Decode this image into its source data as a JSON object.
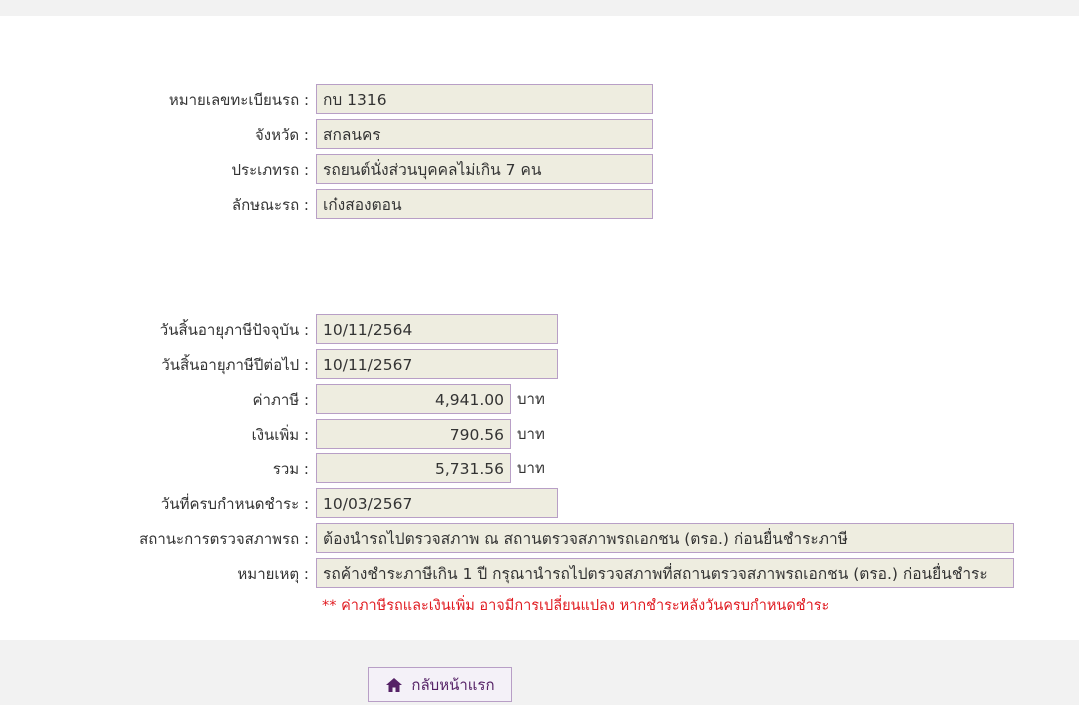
{
  "vehicle": {
    "plate_label": "หมายเลขทะเบียนรถ :",
    "plate_value": "กบ 1316",
    "province_label": "จังหวัด :",
    "province_value": "สกลนคร",
    "type_label": "ประเภทรถ :",
    "type_value": "รถยนต์นั่งส่วนบุคคลไม่เกิน 7 คน",
    "style_label": "ลักษณะรถ :",
    "style_value": "เก๋งสองตอน"
  },
  "tax": {
    "current_expiry_label": "วันสิ้นอายุภาษีปัจจุบัน :",
    "current_expiry_value": "10/11/2564",
    "next_expiry_label": "วันสิ้นอายุภาษีปีต่อไป :",
    "next_expiry_value": "10/11/2567",
    "tax_label": "ค่าภาษี :",
    "tax_value": "4,941.00",
    "surcharge_label": "เงินเพิ่ม :",
    "surcharge_value": "790.56",
    "total_label": "รวม :",
    "total_value": "5,731.56",
    "currency": "บาท",
    "due_date_label": "วันที่ครบกำหนดชำระ :",
    "due_date_value": "10/03/2567",
    "inspection_label": "สถานะการตรวจสภาพรถ :",
    "inspection_value": "ต้องนำรถไปตรวจสภาพ ณ สถานตรวจสภาพรถเอกชน (ตรอ.) ก่อนยื่นชำระภาษี",
    "remark_label": "หมายเหตุ :",
    "remark_value": "รถค้างชำระภาษีเกิน 1 ปี กรุณานำรถไปตรวจสภาพที่สถานตรวจสภาพรถเอกชน (ตรอ.) ก่อนยื่นชำระ",
    "warning_note": "** ค่าภาษีรถและเงินเพิ่ม อาจมีการเปลี่ยนแปลง หากชำระหลังวันครบกำหนดชำระ"
  },
  "footer": {
    "home_label": "กลับหน้าแรก",
    "home_icon": "home-icon"
  },
  "colors": {
    "field_bg": "#eeede0",
    "field_border": "#b89fc6",
    "warning": "#e0191f",
    "button_text": "#552266"
  }
}
